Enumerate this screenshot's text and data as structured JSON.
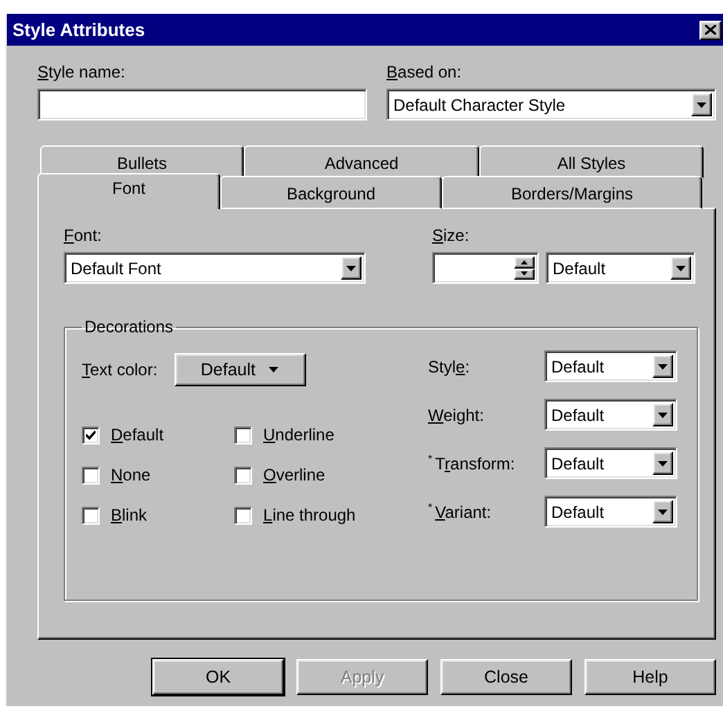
{
  "window": {
    "title": "Style Attributes"
  },
  "style_name": {
    "mnemonic": "S",
    "label_rest": "tyle name:"
  },
  "based_on": {
    "mnemonic": "B",
    "label_rest": "ased on:",
    "value": "Default Character Style"
  },
  "tab_rows": [
    [
      {
        "label": "Bullets",
        "selected": false
      },
      {
        "label": "Advanced",
        "selected": false
      },
      {
        "label": "All Styles",
        "selected": false
      }
    ],
    [
      {
        "label": "Font",
        "selected": true
      },
      {
        "label": "Background",
        "selected": false
      },
      {
        "label": "Borders/Margins",
        "selected": false
      }
    ]
  ],
  "font": {
    "mnemonic": "F",
    "label_rest": "ont:",
    "value": "Default Font"
  },
  "size": {
    "mnemonic": "S",
    "label_rest": "ize:",
    "unit": "Default"
  },
  "decorations": {
    "title": "Decorations",
    "text_color": {
      "mnemonic": "T",
      "label_rest": "ext color:",
      "value": "Default"
    },
    "checkboxes": [
      {
        "mnemonic": "D",
        "label_rest": "efault",
        "checked": true
      },
      {
        "mnemonic": "U",
        "label_rest": "nderline",
        "checked": false
      },
      {
        "mnemonic": "N",
        "label_rest": "one",
        "checked": false
      },
      {
        "mnemonic": "O",
        "label_rest": "verline",
        "checked": false
      },
      {
        "mnemonic": "B",
        "label_rest": "link",
        "checked": false
      },
      {
        "mnemonic": "L",
        "label_rest": "ine through",
        "checked": false
      }
    ],
    "properties": [
      {
        "label_start": "Styl",
        "mnemonic": "e",
        "label_rest": ":",
        "value": "Default"
      },
      {
        "mnemonic": "W",
        "label_rest": "eight:",
        "value": "Default"
      },
      {
        "note": "*",
        "label_start": "T",
        "mnemonic": "r",
        "label_rest": "ansform:",
        "value": "Default"
      },
      {
        "note": "*",
        "mnemonic": "V",
        "label_rest": "ariant:",
        "value": "Default"
      }
    ]
  },
  "buttons": [
    {
      "label": "OK",
      "disabled": false,
      "default": true
    },
    {
      "label": "Apply",
      "disabled": true,
      "default": false
    },
    {
      "label": "Close",
      "disabled": false,
      "default": false
    },
    {
      "label": "Help",
      "disabled": false,
      "default": false
    }
  ]
}
